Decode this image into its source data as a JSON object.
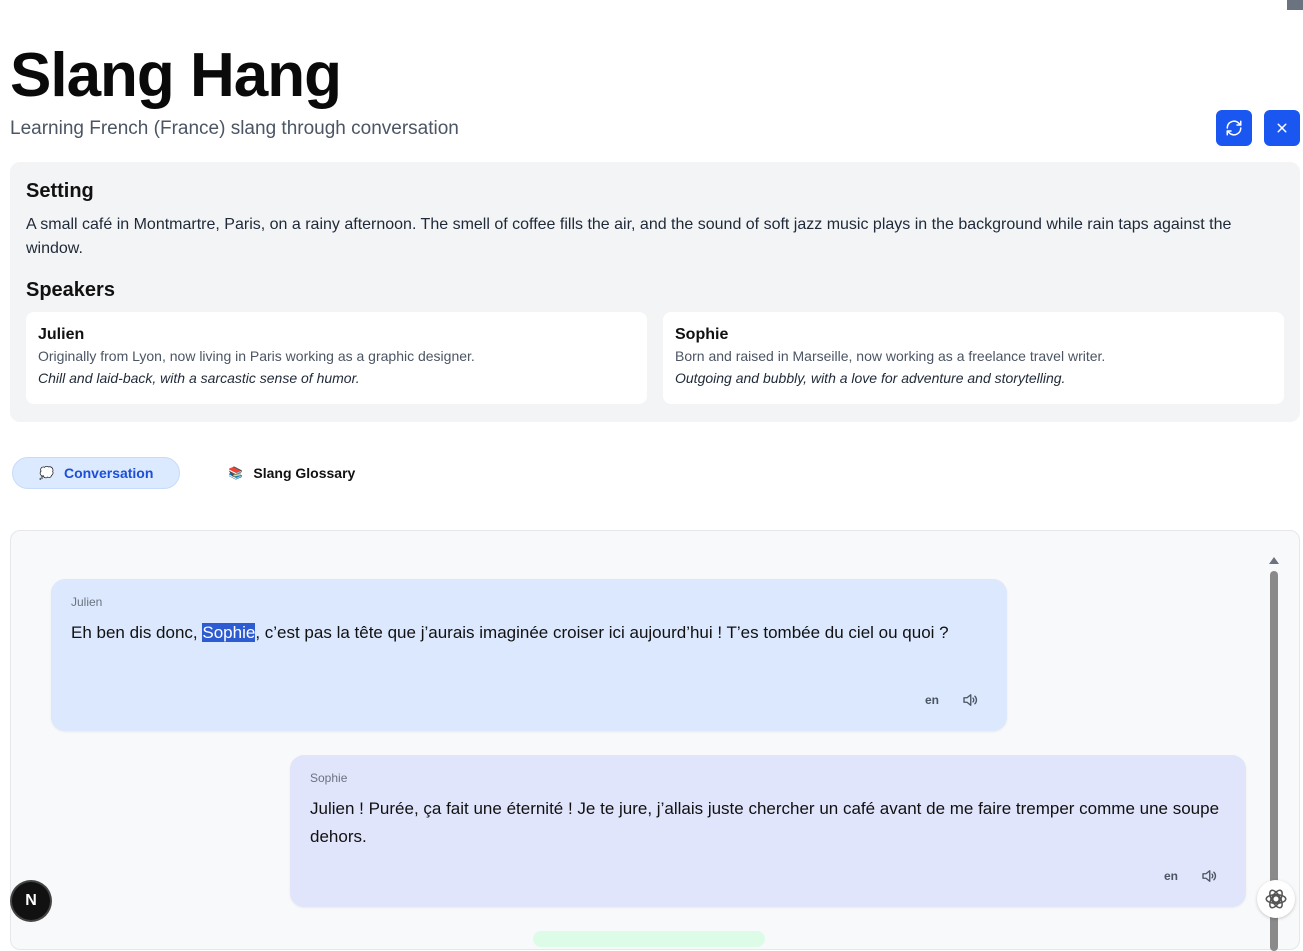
{
  "header": {
    "title": "Slang Hang",
    "subtitle": "Learning French (France) slang through conversation"
  },
  "icons": {
    "refresh": "refresh-icon",
    "close": "close-icon",
    "speaker": "speaker-icon",
    "conversation": "speech-bubble-icon",
    "glossary": "book-icon"
  },
  "colors": {
    "accent": "#1a56f0",
    "bubble_left": "#dbe8fd",
    "bubble_right": "#e0e5fb",
    "tab_active_bg": "#dbeafe",
    "tab_active_text": "#1d4ed8"
  },
  "setting": {
    "heading": "Setting",
    "text": "A small café in Montmartre, Paris, on a rainy afternoon. The smell of coffee fills the air, and the sound of soft jazz music plays in the background while rain taps against the window."
  },
  "speakers": {
    "heading": "Speakers",
    "list": [
      {
        "name": "Julien",
        "bio": "Originally from Lyon, now living in Paris working as a graphic designer.",
        "personality": "Chill and laid-back, with a sarcastic sense of humor."
      },
      {
        "name": "Sophie",
        "bio": "Born and raised in Marseille, now working as a freelance travel writer.",
        "personality": "Outgoing and bubbly, with a love for adventure and storytelling."
      }
    ]
  },
  "tabs": [
    {
      "label": "Conversation",
      "icon": "💭",
      "active": true
    },
    {
      "label": "Slang Glossary",
      "icon": "📚",
      "active": false
    }
  ],
  "messages": [
    {
      "speaker": "Julien",
      "text_before": "Eh ben dis donc, ",
      "text_highlight": "Sophie",
      "text_after": ", c’est pas la tête que j’aurais imaginée croiser ici aujourd’hui ! T’es tombée du ciel ou quoi ?",
      "lang": "en"
    },
    {
      "speaker": "Sophie",
      "text": "Julien ! Purée, ça fait une éternité ! Je te jure, j’allais juste chercher un café avant de me faire tremper comme une soupe dehors.",
      "lang": "en"
    }
  ],
  "badges": {
    "next": "N"
  }
}
